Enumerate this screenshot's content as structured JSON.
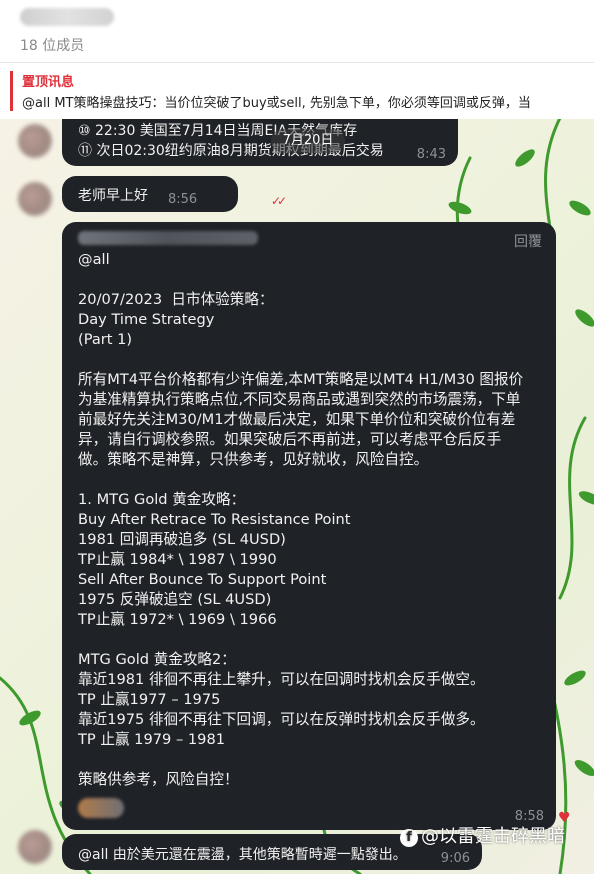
{
  "header": {
    "member_count": "18 位成员"
  },
  "pinned": {
    "title": "置顶讯息",
    "text": "@all  MT策略操盘技巧：当价位突破了buy或sell, 先别急下单，你必须等回调或反弹，当"
  },
  "date_pill": "7月20日",
  "messages": {
    "schedule": {
      "lines": [
        "⑩ 22:30 美国至7月14日当周EIA天然气库存",
        "⑪ 次日02:30纽约原油8月期货期权到期最后交易"
      ],
      "time": "8:43"
    },
    "greeting": {
      "text": "老师早上好",
      "time": "8:56"
    },
    "strategy": {
      "reply_label": "回覆",
      "lines": [
        "@all",
        "",
        "20/07/2023  日市体验策略：",
        "Day Time Strategy",
        "(Part 1)",
        "",
        "所有MT4平台价格都有少许偏差,本MT策略是以MT4 H1/M30 图报价",
        "为基准精算执行策略点位,不同交易商品或遇到突然的市场震荡，下单",
        "前最好先关注M30/M1才做最后决定，如果下单价位和突破价位有差",
        "异，请自行调校参照。如果突破后不再前进，可以考虑平仓后反手",
        "做。策略不是神算，只供参考，见好就收，风险自控。",
        "",
        "1. MTG Gold 黄金攻略：",
        "Buy After Retrace To Resistance Point",
        "1981 回调再破追多 (SL 4USD)",
        "TP止赢 1984* \\ 1987 \\ 1990",
        "Sell After Bounce To Support Point",
        "1975 反弹破追空 (SL 4USD)",
        "TP止赢 1972* \\ 1969 \\ 1966",
        "",
        "MTG Gold 黄金攻略2：",
        "靠近1981 徘徊不再往上攀升，可以在回调时找机会反手做空。",
        "TP 止赢1977 – 1975",
        "靠近1975 徘徊不再往下回调，可以在反弹时找机会反手做多。",
        "TP 止赢 1979 – 1981",
        "",
        "策略供参考，风险自控！"
      ],
      "time": "8:58"
    },
    "last": {
      "text": "@all 由於美元還在震盪，其他策略暫時遲一點發出。",
      "time": "9:06"
    }
  },
  "watermark": "@以雷霆击碎黑暗",
  "watermark_icon": "f",
  "colors": {
    "accent_red": "#e0313b",
    "bubble_dark": "#1f2227",
    "foliage_green": "#3f9a2e"
  }
}
